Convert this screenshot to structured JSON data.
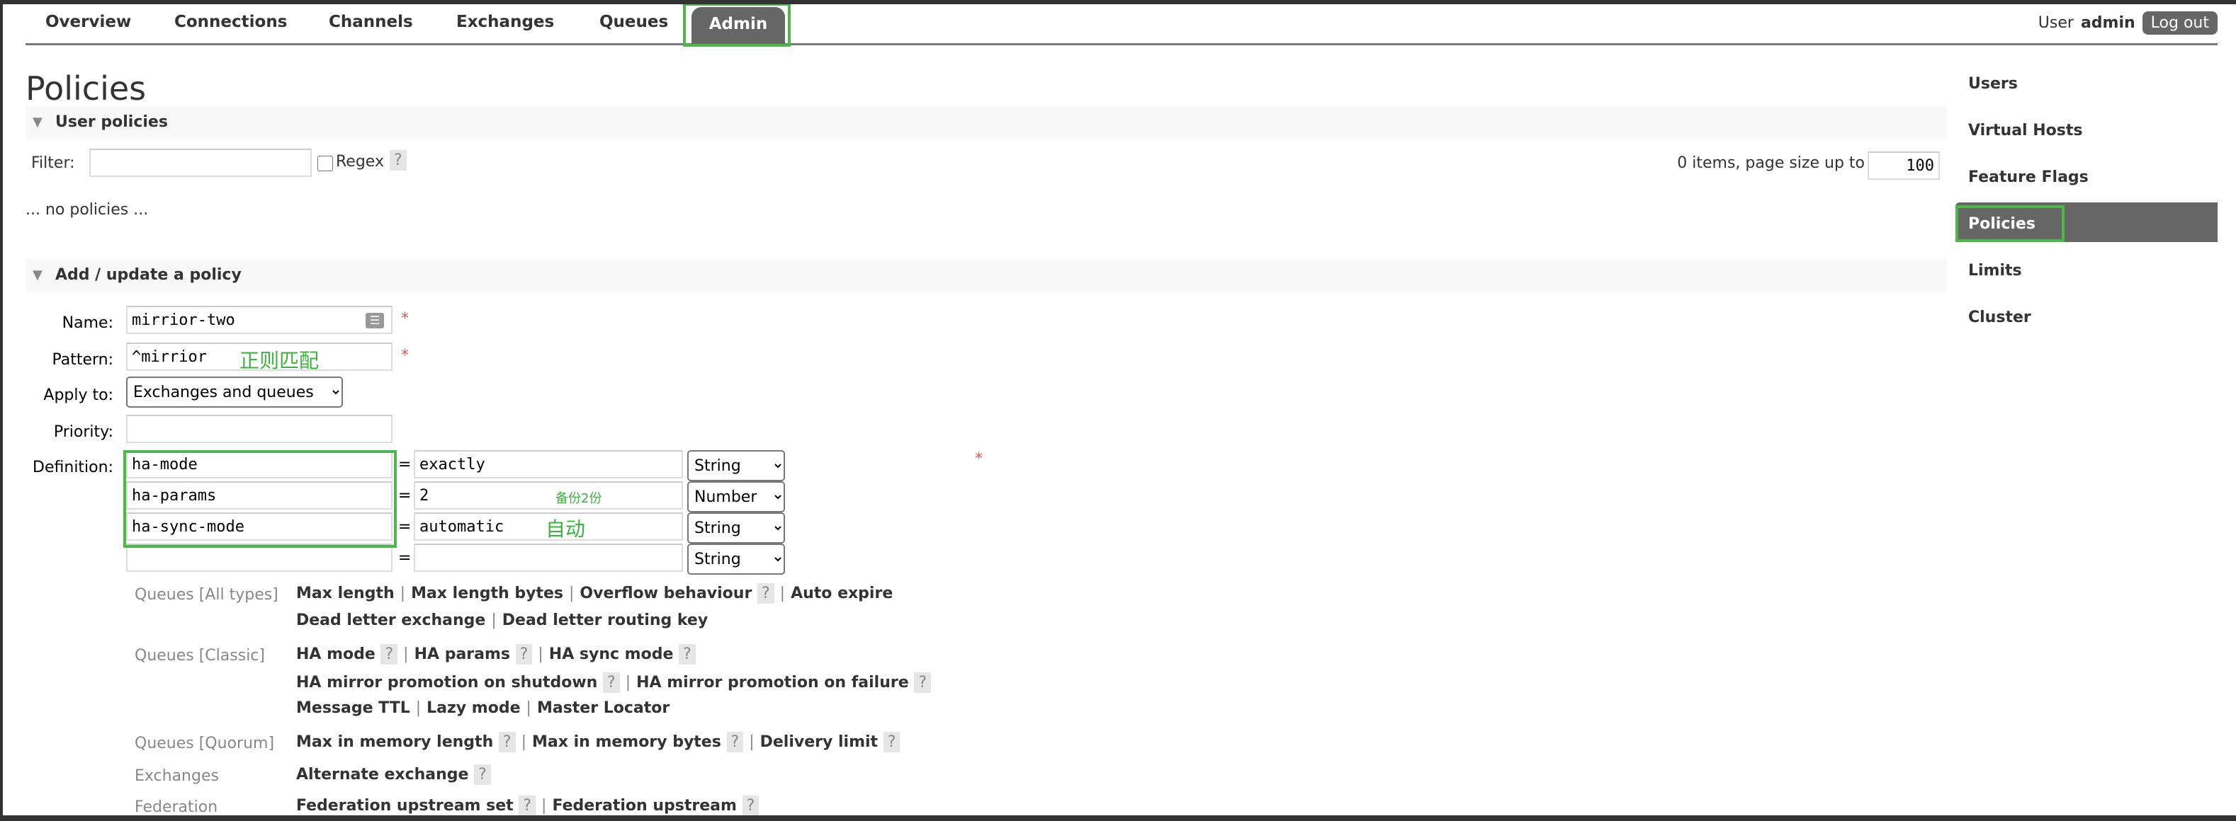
{
  "nav": {
    "tabs": [
      {
        "label": "Overview"
      },
      {
        "label": "Connections"
      },
      {
        "label": "Channels"
      },
      {
        "label": "Exchanges"
      },
      {
        "label": "Queues"
      },
      {
        "label": "Admin",
        "active": true
      }
    ],
    "user_prefix": "User",
    "user_name": "admin",
    "logout": "Log out"
  },
  "page_title": "Policies",
  "user_policies": {
    "title": "User policies",
    "filter_label": "Filter:",
    "filter_value": "",
    "regex_label": "Regex",
    "help": "?",
    "items_text": "0 items, page size up to",
    "page_size": "100",
    "empty_text": "... no policies ..."
  },
  "add_policy": {
    "title": "Add / update a policy",
    "name_label": "Name:",
    "name_value": "mirrior-two",
    "pattern_label": "Pattern:",
    "pattern_value": "^mirrior",
    "pattern_note": "正则匹配",
    "apply_label": "Apply to:",
    "apply_value": "Exchanges and queues",
    "priority_label": "Priority:",
    "priority_value": "",
    "definition_label": "Definition:",
    "required": "*",
    "eq": "=",
    "definitions": [
      {
        "key": "ha-mode",
        "value": "exactly",
        "type": "String",
        "note": ""
      },
      {
        "key": "ha-params",
        "value": "2",
        "type": "Number",
        "note": "备份2份"
      },
      {
        "key": "ha-sync-mode",
        "value": "automatic",
        "type": "String",
        "note": "自动"
      },
      {
        "key": "",
        "value": "",
        "type": "String",
        "note": ""
      }
    ],
    "help_groups": [
      {
        "category": "Queues [All types]",
        "lines": [
          [
            "Max length",
            "Max length bytes",
            "Overflow behaviour ?",
            "Auto expire"
          ],
          [
            "Dead letter exchange",
            "Dead letter routing key"
          ]
        ]
      },
      {
        "category": "Queues [Classic]",
        "lines": [
          [
            "HA mode ?",
            "HA params ?",
            "HA sync mode ?"
          ],
          [
            "HA mirror promotion on shutdown ?",
            "HA mirror promotion on failure ?"
          ],
          [
            "Message TTL",
            "Lazy mode",
            "Master Locator"
          ]
        ]
      },
      {
        "category": "Queues [Quorum]",
        "lines": [
          [
            "Max in memory length ?",
            "Max in memory bytes ?",
            "Delivery limit ?"
          ]
        ]
      },
      {
        "category": "Exchanges",
        "lines": [
          [
            "Alternate exchange ?"
          ]
        ]
      },
      {
        "category": "Federation",
        "lines": [
          [
            "Federation upstream set ?",
            "Federation upstream ?"
          ]
        ]
      }
    ]
  },
  "sidebar": {
    "items": [
      {
        "label": "Users"
      },
      {
        "label": "Virtual Hosts"
      },
      {
        "label": "Feature Flags"
      },
      {
        "label": "Policies",
        "active": true
      },
      {
        "label": "Limits"
      },
      {
        "label": "Cluster"
      }
    ]
  },
  "colors": {
    "accent_highlight": "#4cb84c",
    "active_tab": "#666666",
    "note_text": "#3cb33c",
    "required": "#e55555"
  }
}
